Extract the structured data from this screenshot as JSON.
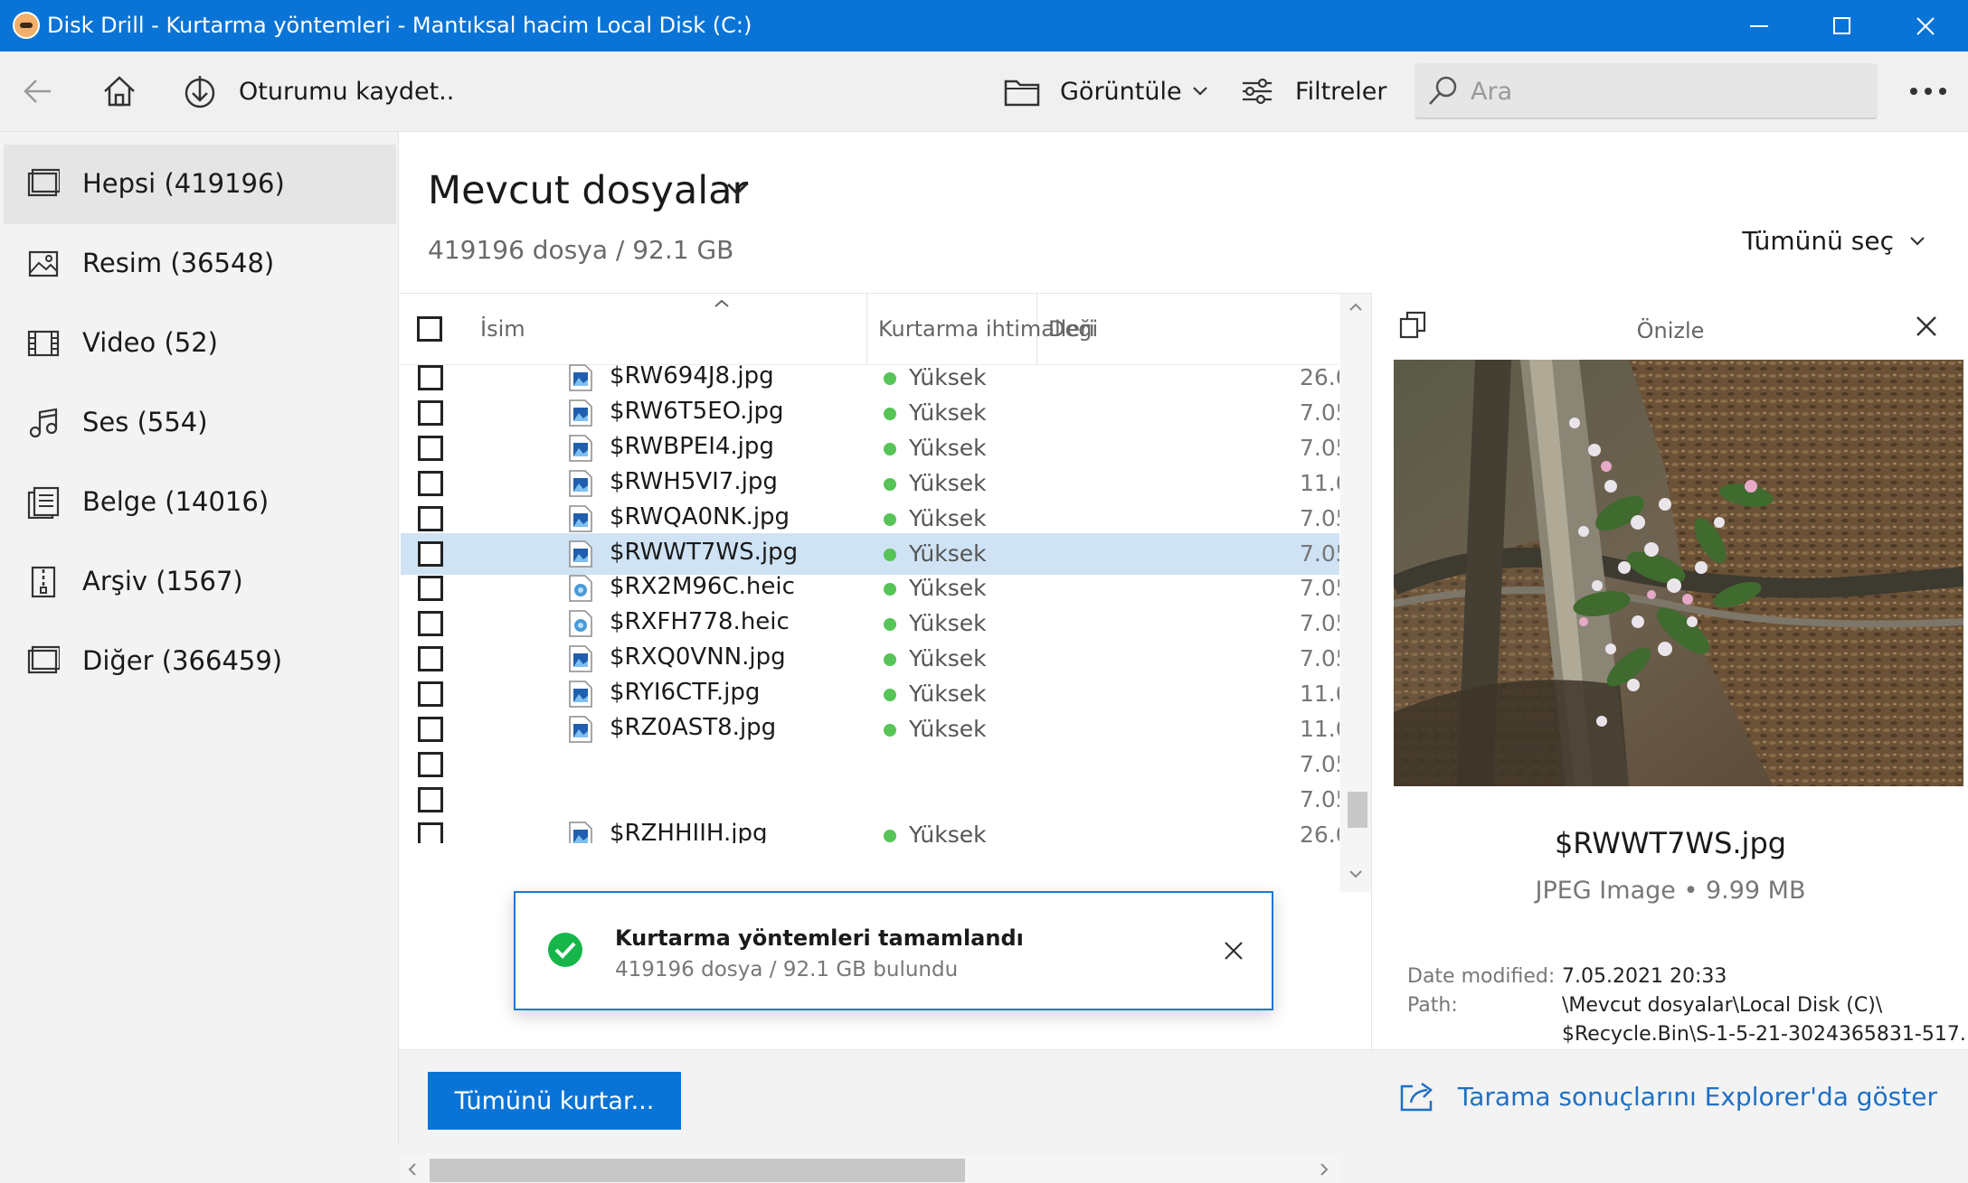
{
  "window": {
    "title": "Disk Drill - Kurtarma yöntemleri - Mantıksal hacim Local Disk (C:)"
  },
  "toolbar": {
    "save_session_label": "Oturumu kaydet..",
    "view_label": "Görüntüle",
    "filters_label": "Filtreler",
    "search_placeholder": "Ara"
  },
  "sidebar": {
    "items": [
      {
        "label": "Hepsi (419196)",
        "icon": "all-files-icon",
        "active": true
      },
      {
        "label": "Resim (36548)",
        "icon": "image-icon"
      },
      {
        "label": "Video (52)",
        "icon": "film-icon"
      },
      {
        "label": "Ses (554)",
        "icon": "music-note-icon"
      },
      {
        "label": "Belge (14016)",
        "icon": "document-icon"
      },
      {
        "label": "Arşiv (1567)",
        "icon": "archive-icon"
      },
      {
        "label": "Diğer (366459)",
        "icon": "other-files-icon"
      }
    ]
  },
  "main": {
    "title": "Mevcut dosyalar",
    "subtitle": "419196 dosya / 92.1 GB",
    "select_all_label": "Tümünü seç"
  },
  "table": {
    "columns": [
      "İsim",
      "Kurtarma ihtimalleri",
      "Deği"
    ],
    "rows": [
      {
        "name": "$RW694J8.jpg",
        "chance": "Yüksek",
        "date": "26.0"
      },
      {
        "name": "$RW6T5EO.jpg",
        "chance": "Yüksek",
        "date": "7.05"
      },
      {
        "name": "$RWBPEI4.jpg",
        "chance": "Yüksek",
        "date": "7.05"
      },
      {
        "name": "$RWH5VI7.jpg",
        "chance": "Yüksek",
        "date": "11.0"
      },
      {
        "name": "$RWQA0NK.jpg",
        "chance": "Yüksek",
        "date": "7.05"
      },
      {
        "name": "$RWWT7WS.jpg",
        "chance": "Yüksek",
        "date": "7.05",
        "selected": true
      },
      {
        "name": "$RX2M96C.heic",
        "chance": "Yüksek",
        "date": "7.05"
      },
      {
        "name": "$RXFH778.heic",
        "chance": "Yüksek",
        "date": "7.05"
      },
      {
        "name": "$RXQ0VNN.jpg",
        "chance": "Yüksek",
        "date": "7.05"
      },
      {
        "name": "$RYI6CTF.jpg",
        "chance": "Yüksek",
        "date": "11.0"
      },
      {
        "name": "$RZ0AST8.jpg",
        "chance": "Yüksek",
        "date": "11.0"
      },
      {
        "name": "",
        "chance": "",
        "date": "7.05"
      },
      {
        "name": "",
        "chance": "",
        "date": "7.05"
      },
      {
        "name": "$RZHHIIH.jpg",
        "chance": "Yüksek",
        "date": "26.0"
      }
    ]
  },
  "toast": {
    "title": "Kurtarma yöntemleri tamamlandı",
    "message": "419196 dosya / 92.1 GB bulundu"
  },
  "preview": {
    "header": "Önizle",
    "file_name": "$RWWT7WS.jpg",
    "file_type": "JPEG Image • 9.99 MB",
    "date_modified_label": "Date modified:",
    "date_modified_value": "7.05.2021 20:33",
    "path_label": "Path:",
    "path_line1": "\\Mevcut dosyalar\\Local Disk (C)\\",
    "path_line2": "$Recycle.Bin\\S-1-5-21-3024365831-517..."
  },
  "bottom": {
    "recover_all_label": "Tümünü kurtar...",
    "explorer_link_label": "Tarama sonuçlarını Explorer'da göster"
  },
  "colors": {
    "accent": "#0a74d6",
    "selected_row": "#cfe3f5",
    "status_green": "#57c457"
  }
}
